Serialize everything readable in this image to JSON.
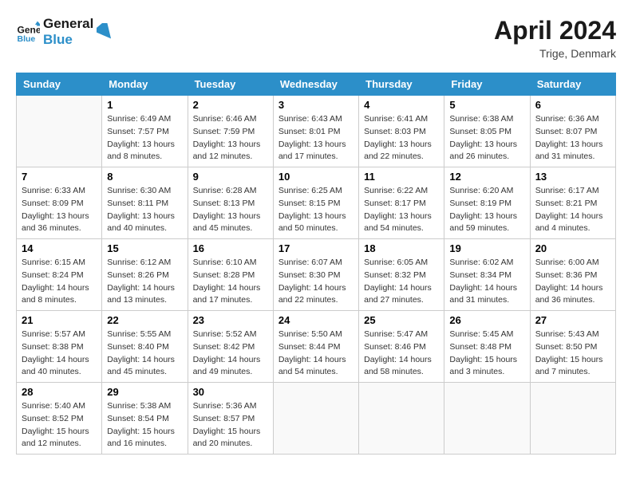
{
  "header": {
    "logo_line1": "General",
    "logo_line2": "Blue",
    "month_title": "April 2024",
    "subtitle": "Trige, Denmark"
  },
  "days_of_week": [
    "Sunday",
    "Monday",
    "Tuesday",
    "Wednesday",
    "Thursday",
    "Friday",
    "Saturday"
  ],
  "weeks": [
    [
      {
        "day": "",
        "info": []
      },
      {
        "day": "1",
        "info": [
          "Sunrise: 6:49 AM",
          "Sunset: 7:57 PM",
          "Daylight: 13 hours",
          "and 8 minutes."
        ]
      },
      {
        "day": "2",
        "info": [
          "Sunrise: 6:46 AM",
          "Sunset: 7:59 PM",
          "Daylight: 13 hours",
          "and 12 minutes."
        ]
      },
      {
        "day": "3",
        "info": [
          "Sunrise: 6:43 AM",
          "Sunset: 8:01 PM",
          "Daylight: 13 hours",
          "and 17 minutes."
        ]
      },
      {
        "day": "4",
        "info": [
          "Sunrise: 6:41 AM",
          "Sunset: 8:03 PM",
          "Daylight: 13 hours",
          "and 22 minutes."
        ]
      },
      {
        "day": "5",
        "info": [
          "Sunrise: 6:38 AM",
          "Sunset: 8:05 PM",
          "Daylight: 13 hours",
          "and 26 minutes."
        ]
      },
      {
        "day": "6",
        "info": [
          "Sunrise: 6:36 AM",
          "Sunset: 8:07 PM",
          "Daylight: 13 hours",
          "and 31 minutes."
        ]
      }
    ],
    [
      {
        "day": "7",
        "info": [
          "Sunrise: 6:33 AM",
          "Sunset: 8:09 PM",
          "Daylight: 13 hours",
          "and 36 minutes."
        ]
      },
      {
        "day": "8",
        "info": [
          "Sunrise: 6:30 AM",
          "Sunset: 8:11 PM",
          "Daylight: 13 hours",
          "and 40 minutes."
        ]
      },
      {
        "day": "9",
        "info": [
          "Sunrise: 6:28 AM",
          "Sunset: 8:13 PM",
          "Daylight: 13 hours",
          "and 45 minutes."
        ]
      },
      {
        "day": "10",
        "info": [
          "Sunrise: 6:25 AM",
          "Sunset: 8:15 PM",
          "Daylight: 13 hours",
          "and 50 minutes."
        ]
      },
      {
        "day": "11",
        "info": [
          "Sunrise: 6:22 AM",
          "Sunset: 8:17 PM",
          "Daylight: 13 hours",
          "and 54 minutes."
        ]
      },
      {
        "day": "12",
        "info": [
          "Sunrise: 6:20 AM",
          "Sunset: 8:19 PM",
          "Daylight: 13 hours",
          "and 59 minutes."
        ]
      },
      {
        "day": "13",
        "info": [
          "Sunrise: 6:17 AM",
          "Sunset: 8:21 PM",
          "Daylight: 14 hours",
          "and 4 minutes."
        ]
      }
    ],
    [
      {
        "day": "14",
        "info": [
          "Sunrise: 6:15 AM",
          "Sunset: 8:24 PM",
          "Daylight: 14 hours",
          "and 8 minutes."
        ]
      },
      {
        "day": "15",
        "info": [
          "Sunrise: 6:12 AM",
          "Sunset: 8:26 PM",
          "Daylight: 14 hours",
          "and 13 minutes."
        ]
      },
      {
        "day": "16",
        "info": [
          "Sunrise: 6:10 AM",
          "Sunset: 8:28 PM",
          "Daylight: 14 hours",
          "and 17 minutes."
        ]
      },
      {
        "day": "17",
        "info": [
          "Sunrise: 6:07 AM",
          "Sunset: 8:30 PM",
          "Daylight: 14 hours",
          "and 22 minutes."
        ]
      },
      {
        "day": "18",
        "info": [
          "Sunrise: 6:05 AM",
          "Sunset: 8:32 PM",
          "Daylight: 14 hours",
          "and 27 minutes."
        ]
      },
      {
        "day": "19",
        "info": [
          "Sunrise: 6:02 AM",
          "Sunset: 8:34 PM",
          "Daylight: 14 hours",
          "and 31 minutes."
        ]
      },
      {
        "day": "20",
        "info": [
          "Sunrise: 6:00 AM",
          "Sunset: 8:36 PM",
          "Daylight: 14 hours",
          "and 36 minutes."
        ]
      }
    ],
    [
      {
        "day": "21",
        "info": [
          "Sunrise: 5:57 AM",
          "Sunset: 8:38 PM",
          "Daylight: 14 hours",
          "and 40 minutes."
        ]
      },
      {
        "day": "22",
        "info": [
          "Sunrise: 5:55 AM",
          "Sunset: 8:40 PM",
          "Daylight: 14 hours",
          "and 45 minutes."
        ]
      },
      {
        "day": "23",
        "info": [
          "Sunrise: 5:52 AM",
          "Sunset: 8:42 PM",
          "Daylight: 14 hours",
          "and 49 minutes."
        ]
      },
      {
        "day": "24",
        "info": [
          "Sunrise: 5:50 AM",
          "Sunset: 8:44 PM",
          "Daylight: 14 hours",
          "and 54 minutes."
        ]
      },
      {
        "day": "25",
        "info": [
          "Sunrise: 5:47 AM",
          "Sunset: 8:46 PM",
          "Daylight: 14 hours",
          "and 58 minutes."
        ]
      },
      {
        "day": "26",
        "info": [
          "Sunrise: 5:45 AM",
          "Sunset: 8:48 PM",
          "Daylight: 15 hours",
          "and 3 minutes."
        ]
      },
      {
        "day": "27",
        "info": [
          "Sunrise: 5:43 AM",
          "Sunset: 8:50 PM",
          "Daylight: 15 hours",
          "and 7 minutes."
        ]
      }
    ],
    [
      {
        "day": "28",
        "info": [
          "Sunrise: 5:40 AM",
          "Sunset: 8:52 PM",
          "Daylight: 15 hours",
          "and 12 minutes."
        ]
      },
      {
        "day": "29",
        "info": [
          "Sunrise: 5:38 AM",
          "Sunset: 8:54 PM",
          "Daylight: 15 hours",
          "and 16 minutes."
        ]
      },
      {
        "day": "30",
        "info": [
          "Sunrise: 5:36 AM",
          "Sunset: 8:57 PM",
          "Daylight: 15 hours",
          "and 20 minutes."
        ]
      },
      {
        "day": "",
        "info": []
      },
      {
        "day": "",
        "info": []
      },
      {
        "day": "",
        "info": []
      },
      {
        "day": "",
        "info": []
      }
    ]
  ]
}
